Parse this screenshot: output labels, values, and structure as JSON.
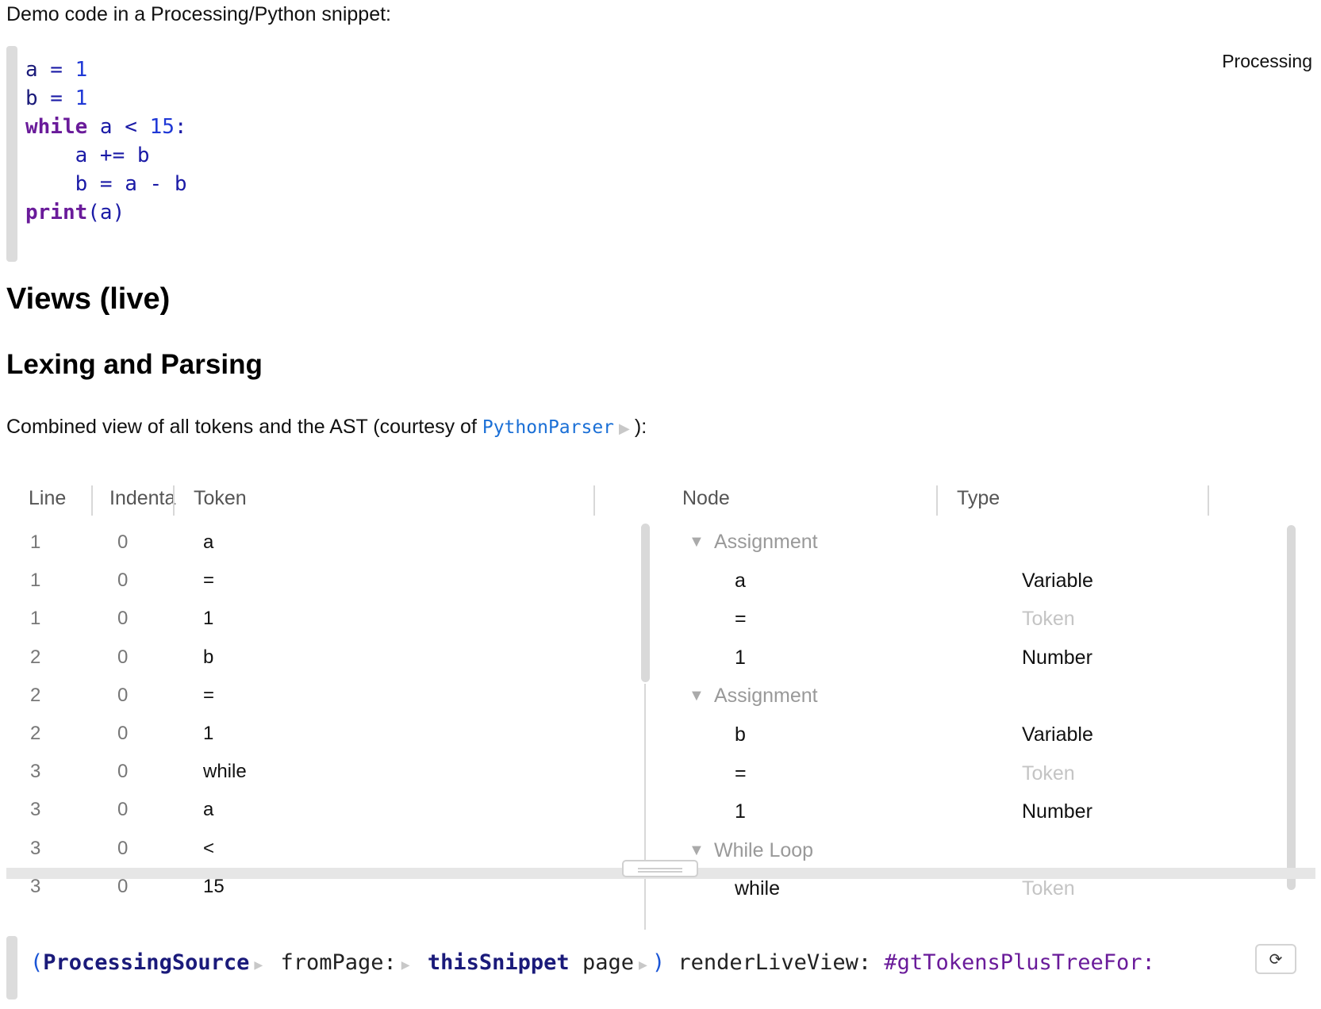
{
  "intro": "Demo code in a Processing/Python snippet:",
  "snippet": {
    "language": "Processing",
    "lines": [
      {
        "parts": [
          {
            "t": "a",
            "c": "ident"
          },
          {
            "t": " = ",
            "c": ""
          },
          {
            "t": "1",
            "c": "num"
          }
        ]
      },
      {
        "parts": [
          {
            "t": "b",
            "c": "ident"
          },
          {
            "t": " = ",
            "c": ""
          },
          {
            "t": "1",
            "c": "num"
          }
        ]
      },
      {
        "parts": [
          {
            "t": "while",
            "c": "kw"
          },
          {
            "t": " a < ",
            "c": ""
          },
          {
            "t": "15",
            "c": "num"
          },
          {
            "t": ":",
            "c": ""
          }
        ]
      },
      {
        "parts": [
          {
            "t": "    a += b",
            "c": ""
          }
        ]
      },
      {
        "parts": [
          {
            "t": "    b = a - b",
            "c": ""
          }
        ]
      },
      {
        "parts": [
          {
            "t": "print",
            "c": "kw"
          },
          {
            "t": "(a)",
            "c": ""
          }
        ]
      }
    ]
  },
  "heading_views": "Views (live)",
  "heading_lexing": "Lexing and Parsing",
  "paragraph": {
    "before": "Combined view of all tokens and the AST (courtesy of ",
    "link": "PythonParser",
    "after": "):"
  },
  "tokens_table": {
    "headers": {
      "line": "Line",
      "indentation": "Indenta",
      "token": "Token"
    },
    "rows": [
      {
        "line": "1",
        "indent": "0",
        "token": "a"
      },
      {
        "line": "1",
        "indent": "0",
        "token": "="
      },
      {
        "line": "1",
        "indent": "0",
        "token": "1"
      },
      {
        "line": "2",
        "indent": "0",
        "token": "b"
      },
      {
        "line": "2",
        "indent": "0",
        "token": "="
      },
      {
        "line": "2",
        "indent": "0",
        "token": "1"
      },
      {
        "line": "3",
        "indent": "0",
        "token": "while"
      },
      {
        "line": "3",
        "indent": "0",
        "token": "a"
      },
      {
        "line": "3",
        "indent": "0",
        "token": "<"
      },
      {
        "line": "3",
        "indent": "0",
        "token": "15"
      }
    ]
  },
  "tree_table": {
    "headers": {
      "node": "Node",
      "type": "Type"
    },
    "rows": [
      {
        "kind": "group",
        "node": "Assignment",
        "type": ""
      },
      {
        "kind": "leaf",
        "node": "a",
        "type": "Variable",
        "faint": false
      },
      {
        "kind": "leaf",
        "node": "=",
        "type": "Token",
        "faint": true
      },
      {
        "kind": "leaf",
        "node": "1",
        "type": "Number",
        "faint": false
      },
      {
        "kind": "group",
        "node": "Assignment",
        "type": ""
      },
      {
        "kind": "leaf",
        "node": "b",
        "type": "Variable",
        "faint": false
      },
      {
        "kind": "leaf",
        "node": "=",
        "type": "Token",
        "faint": true
      },
      {
        "kind": "leaf",
        "node": "1",
        "type": "Number",
        "faint": false
      },
      {
        "kind": "group",
        "node": "While Loop",
        "type": ""
      },
      {
        "kind": "leaf",
        "node": "while",
        "type": "Token",
        "faint": true
      }
    ]
  },
  "expression": {
    "open": "(",
    "class": "ProcessingSource",
    "msg1": " fromPage:",
    "arg": " thisSnippet",
    "msg2": " page",
    "close": ")",
    "msg3": " renderLiveView: ",
    "symbol": "#gtTokensPlusTreeFor:"
  },
  "icons": {
    "expand": "triangle-right-icon",
    "collapse": "triangle-down-icon",
    "refresh": "refresh-icon"
  }
}
